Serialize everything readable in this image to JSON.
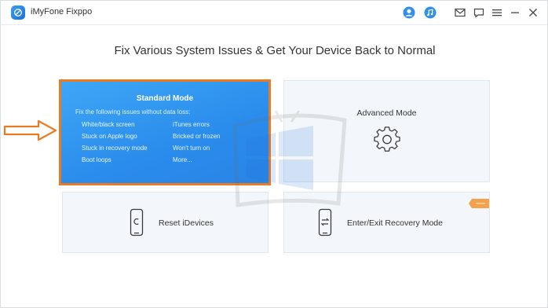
{
  "app": {
    "title": "iMyFone Fixppo"
  },
  "titlebar": {
    "icons": [
      "user-icon",
      "music-icon",
      "mail-icon",
      "feedback-icon",
      "menu-icon",
      "minimize-icon",
      "close-icon"
    ]
  },
  "headline": "Fix Various System Issues & Get Your Device Back to Normal",
  "cards": {
    "standard": {
      "title": "Standard Mode",
      "description": "Fix the following issues without data loss:",
      "issues_left": [
        "White/black screen",
        "Stuck on Apple logo",
        "Stuck in recovery mode",
        "Boot loops"
      ],
      "issues_right": [
        "iTunes errors",
        "Bricked or frozen",
        "Won't turn on",
        "More..."
      ]
    },
    "advanced": {
      "title": "Advanced Mode",
      "icon": "gear-icon"
    },
    "reset": {
      "title": "Reset iDevices",
      "icon": "phone-reset-icon"
    },
    "recovery": {
      "title": "Enter/Exit Recovery Mode",
      "icon": "phone-recovery-icon",
      "tag_color": "#f5a04a"
    }
  },
  "colors": {
    "accent_blue": "#2a8cec",
    "highlight_orange": "#ec7a22",
    "card_bg": "#f3f7fb"
  }
}
